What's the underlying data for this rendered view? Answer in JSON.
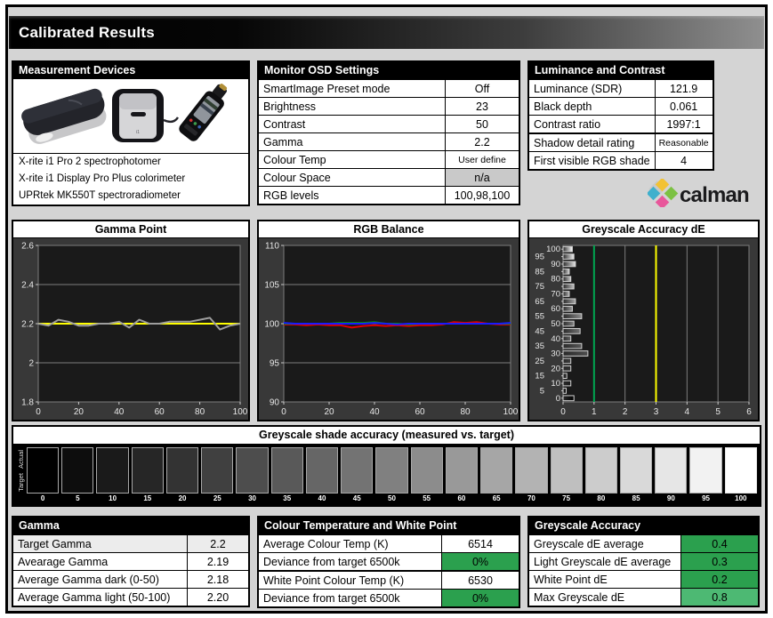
{
  "page_title": "Calibrated Results",
  "colors": {
    "accent_green": "#2BA04E",
    "accent_green_light": "#4DB973",
    "na_grey": "#C9C9C9",
    "target_yellow": "#FFFF00",
    "ref_green": "#00A651",
    "measured_grey": "#9E9E9E",
    "line_red": "#E00000",
    "line_green": "#009900",
    "line_blue": "#1A1AFF"
  },
  "measurement_devices": {
    "title": "Measurement Devices",
    "devices": [
      "X-rite i1 Pro 2 spectrophotomer",
      "X-rite i1 Display Pro Plus colorimeter",
      "UPRtek MK550T spectroradiometer"
    ]
  },
  "monitor_osd": {
    "title": "Monitor OSD Settings",
    "rows": [
      {
        "label": "SmartImage Preset mode",
        "value": "Off"
      },
      {
        "label": "Brightness",
        "value": "23"
      },
      {
        "label": "Contrast",
        "value": "50"
      },
      {
        "label": "Gamma",
        "value": "2.2"
      },
      {
        "label": "Colour Temp",
        "value": "User define",
        "value_small": true
      },
      {
        "label": "Colour Space",
        "value": "n/a",
        "value_style": "grey"
      },
      {
        "label": "RGB levels",
        "value": "100,98,100"
      }
    ]
  },
  "luminance": {
    "title": "Luminance and Contrast",
    "rows": [
      {
        "label": "Luminance (SDR)",
        "value": "121.9"
      },
      {
        "label": "Black depth",
        "value": "0.061"
      },
      {
        "label": "Contrast ratio",
        "value": "1997:1"
      },
      {
        "label": "Shadow detail rating",
        "value": "Reasonable",
        "group_start": true,
        "value_small": true
      },
      {
        "label": "First visible RGB shade",
        "value": "4"
      }
    ]
  },
  "logo": {
    "wordmark": "calman"
  },
  "gamma_summary": {
    "title": "Gamma",
    "rows": [
      {
        "label": "Target Gamma",
        "value": "2.2",
        "shaded": true
      },
      {
        "label": "Avearage Gamma",
        "value": "2.19"
      },
      {
        "label": "Average Gamma dark (0-50)",
        "value": "2.18"
      },
      {
        "label": "Average Gamma light (50-100)",
        "value": "2.20"
      }
    ]
  },
  "colour_temp_summary": {
    "title": "Colour Temperature and White Point",
    "rows": [
      {
        "label": "Average Colour Temp (K)",
        "value": "6514"
      },
      {
        "label": "Deviance from target 6500k",
        "value": "0%",
        "value_style": "green"
      },
      {
        "label": "White Point Colour Temp (K)",
        "value": "6530",
        "group_start": true
      },
      {
        "label": "Deviance from target 6500k",
        "value": "0%",
        "value_style": "green"
      }
    ]
  },
  "greyscale_summary": {
    "title": "Greyscale Accuracy",
    "rows": [
      {
        "label": "Greyscale dE average",
        "value": "0.4",
        "value_style": "green"
      },
      {
        "label": "Light Greyscale dE average",
        "value": "0.3",
        "value_style": "green"
      },
      {
        "label": "White Point dE",
        "value": "0.2",
        "value_style": "green"
      },
      {
        "label": "Max Greyscale dE",
        "value": "0.8",
        "value_style": "green-light"
      }
    ]
  },
  "chart_data": [
    {
      "id": "gamma-point",
      "type": "line",
      "title": "Gamma Point",
      "x": [
        0,
        5,
        10,
        15,
        20,
        25,
        30,
        35,
        40,
        45,
        50,
        55,
        60,
        65,
        70,
        75,
        80,
        85,
        90,
        95,
        100
      ],
      "xlim": [
        0,
        100
      ],
      "ylim": [
        1.8,
        2.6
      ],
      "yticks": [
        1.8,
        2,
        2.2,
        2.4,
        2.6
      ],
      "xticks": [
        0,
        20,
        40,
        60,
        80,
        100
      ],
      "target_line": {
        "y": 2.2,
        "color": "#FFFF00",
        "name": "target gamma 2.2"
      },
      "series": [
        {
          "name": "Measured gamma",
          "color": "#9E9E9E",
          "values": [
            2.2,
            2.19,
            2.22,
            2.21,
            2.19,
            2.19,
            2.2,
            2.2,
            2.21,
            2.18,
            2.22,
            2.2,
            2.2,
            2.21,
            2.21,
            2.21,
            2.22,
            2.23,
            2.17,
            2.19,
            2.2
          ]
        }
      ]
    },
    {
      "id": "rgb-balance",
      "type": "line",
      "title": "RGB Balance",
      "x": [
        0,
        5,
        10,
        15,
        20,
        25,
        30,
        35,
        40,
        45,
        50,
        55,
        60,
        65,
        70,
        75,
        80,
        85,
        90,
        95,
        100
      ],
      "xlim": [
        0,
        100
      ],
      "ylim": [
        90,
        110
      ],
      "yticks": [
        90,
        95,
        100,
        105,
        110
      ],
      "xticks": [
        0,
        20,
        40,
        60,
        80,
        100
      ],
      "series": [
        {
          "name": "Red",
          "color": "#E00000",
          "values": [
            99.9,
            99.9,
            99.8,
            99.9,
            99.8,
            99.8,
            99.5,
            99.7,
            99.8,
            99.7,
            99.8,
            99.7,
            99.8,
            99.8,
            99.9,
            100.2,
            100.1,
            100.2,
            100.0,
            99.9,
            99.9
          ]
        },
        {
          "name": "Green",
          "color": "#009900",
          "values": [
            100.0,
            100.0,
            100.0,
            100.0,
            100.0,
            100.1,
            100.1,
            100.1,
            100.2,
            100.0,
            100.0,
            99.9,
            100.0,
            100.0,
            100.0,
            100.0,
            100.0,
            100.0,
            100.0,
            100.0,
            100.0
          ]
        },
        {
          "name": "Blue",
          "color": "#1A1AFF",
          "values": [
            100.1,
            100.0,
            100.0,
            100.0,
            100.0,
            100.0,
            100.0,
            100.0,
            100.1,
            100.0,
            99.9,
            100.0,
            100.0,
            100.0,
            100.0,
            100.0,
            100.0,
            100.0,
            100.0,
            100.0,
            100.1
          ]
        }
      ]
    },
    {
      "id": "greyscale-accuracy-de",
      "type": "bar",
      "title": "Greyscale Accuracy dE",
      "categories": [
        0,
        5,
        10,
        15,
        20,
        25,
        30,
        35,
        40,
        45,
        50,
        55,
        60,
        65,
        70,
        75,
        80,
        85,
        90,
        95,
        100
      ],
      "values": [
        0.35,
        0.1,
        0.25,
        0.12,
        0.25,
        0.25,
        0.8,
        0.6,
        0.25,
        0.55,
        0.35,
        0.6,
        0.3,
        0.4,
        0.2,
        0.35,
        0.25,
        0.2,
        0.4,
        0.35,
        0.3
      ],
      "xlim": [
        0,
        6
      ],
      "xticks": [
        0,
        1,
        2,
        3,
        4,
        5,
        6
      ],
      "ref_lines": [
        {
          "x": 1,
          "color": "#00A651",
          "name": "dE 1 reference"
        },
        {
          "x": 3,
          "color": "#FFFF00",
          "name": "dE 3 reference"
        }
      ]
    },
    {
      "id": "greyscale-strip",
      "type": "swatch-strip",
      "title": "Greyscale shade accuracy (measured vs. target)",
      "row_labels": [
        "Actual",
        "Target"
      ],
      "levels": [
        0,
        5,
        10,
        15,
        20,
        25,
        30,
        35,
        40,
        45,
        50,
        55,
        60,
        65,
        70,
        75,
        80,
        85,
        90,
        95,
        100
      ]
    }
  ]
}
